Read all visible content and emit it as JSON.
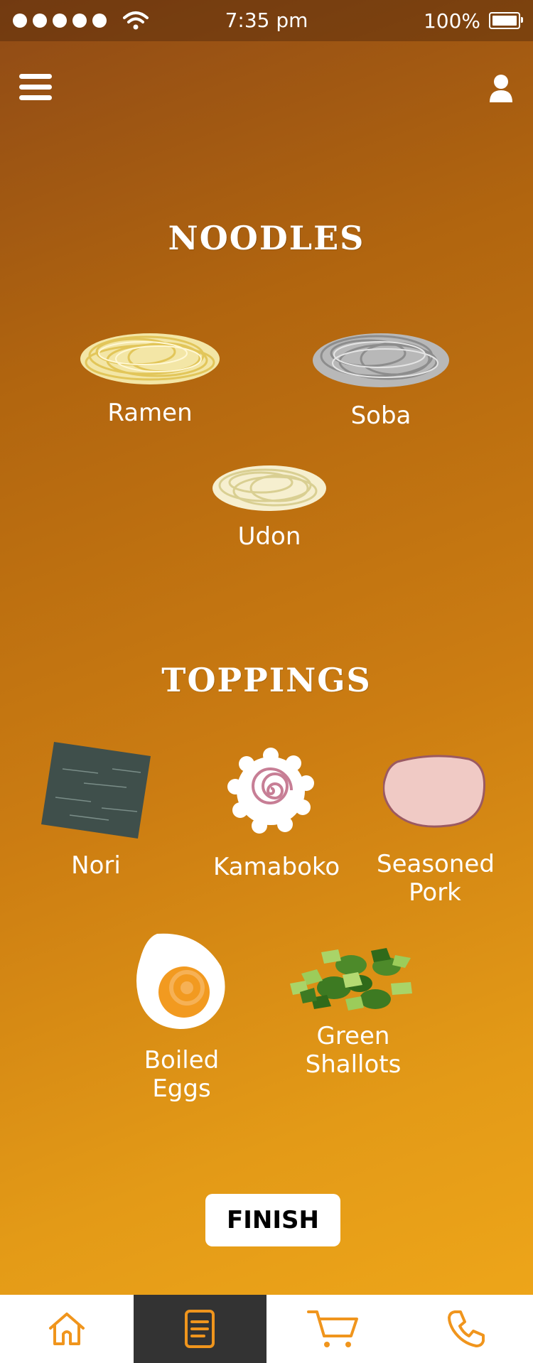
{
  "status": {
    "time": "7:35 pm",
    "battery": "100%"
  },
  "noodles": {
    "title": "NOODLES",
    "items": [
      {
        "label": "Ramen"
      },
      {
        "label": "Soba"
      },
      {
        "label": "Udon"
      }
    ]
  },
  "toppings": {
    "title": "TOPPINGS",
    "items": [
      {
        "label": "Nori"
      },
      {
        "label": "Kamaboko"
      },
      {
        "label": "Seasoned\nPork"
      },
      {
        "label": "Boiled\nEggs"
      },
      {
        "label": "Green\nShallots"
      }
    ]
  },
  "actions": {
    "finish": "FINISH"
  },
  "tabbar": {
    "active": "orders",
    "tabs": [
      "home-icon",
      "document-icon",
      "cart-icon",
      "phone-icon"
    ]
  },
  "colors": {
    "accent": "#f0951d",
    "tab_active": "#333333"
  }
}
